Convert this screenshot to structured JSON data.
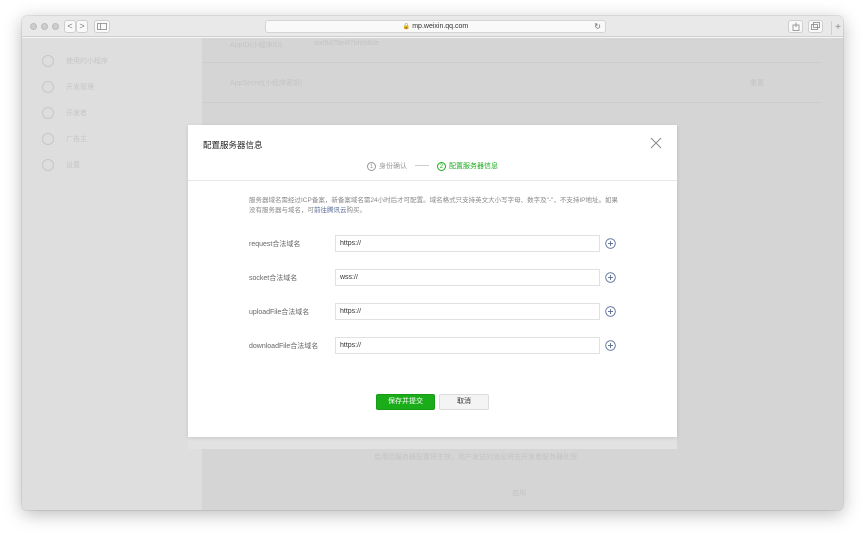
{
  "browser": {
    "url": "mp.weixin.qq.com",
    "back_label": "<",
    "forward_label": ">",
    "reload_glyph": "↻",
    "new_tab_glyph": "+"
  },
  "background": {
    "sidebar_items": [
      "使用的小程序",
      "开发管理",
      "开发者",
      "广告主",
      "设置"
    ],
    "main_texts": [
      "AppID(小程序ID)",
      "wxf9d79e4f7bfeb8de",
      "AppSecret(小程序密钥)",
      "重置",
      "启用后服务器配置将生效，用户发送的消息将由开发者服务器处理",
      "启用"
    ]
  },
  "modal": {
    "title": "配置服务器信息",
    "steps": [
      {
        "num": "1",
        "label": "身份确认",
        "active": false
      },
      {
        "num": "2",
        "label": "配置服务器信息",
        "active": true
      }
    ],
    "description_part1": "服务器域名需经过ICP备案，新备案域名需24小时后才可配置。域名格式只支持英文大小写字母、数字及\"-\"，不支持IP地址。如果没有服务器与域名，可",
    "description_link": "前往腾讯云",
    "description_part2": "购买。",
    "rows": [
      {
        "label": "request合法域名",
        "value": "https://"
      },
      {
        "label": "socket合法域名",
        "value": "wss://"
      },
      {
        "label": "uploadFile合法域名",
        "value": "https://"
      },
      {
        "label": "downloadFile合法域名",
        "value": "https://"
      }
    ],
    "submit_label": "保存并提交",
    "cancel_label": "取消"
  },
  "colors": {
    "accent": "#1aad19",
    "link": "#576b95",
    "overlay": "#d9d9d9"
  },
  "icons": {
    "close": "close-icon",
    "add": "plus-circle-icon",
    "lock": "lock-icon",
    "sidebar_toggle": "sidebar-icon",
    "share": "share-icon",
    "tabs": "tabs-icon"
  }
}
